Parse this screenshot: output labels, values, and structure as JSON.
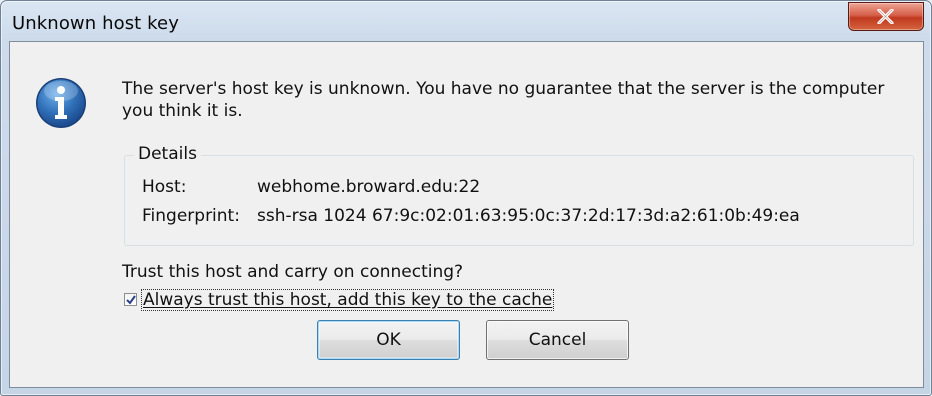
{
  "window": {
    "title": "Unknown host key"
  },
  "dialog": {
    "message": "The server's host key is unknown. You have no guarantee that the server is the computer you think it is.",
    "details": {
      "legend": "Details",
      "host_label": "Host:",
      "host_value": "webhome.broward.edu:22",
      "fingerprint_label": "Fingerprint:",
      "fingerprint_value": "ssh-rsa 1024 67:9c:02:01:63:95:0c:37:2d:17:3d:a2:61:0b:49:ea"
    },
    "question": "Trust this host and carry on connecting?",
    "checkbox": {
      "label": "Always trust this host, add this key to the cache",
      "checked": true
    },
    "buttons": {
      "ok": "OK",
      "cancel": "Cancel"
    }
  },
  "icons": {
    "info": "information-icon",
    "close": "close-icon",
    "check": "checkmark-icon"
  },
  "colors": {
    "close_button": "#c94a31",
    "info_icon": "#2f6fb7",
    "dialog_bg": "#f0f0f0"
  }
}
